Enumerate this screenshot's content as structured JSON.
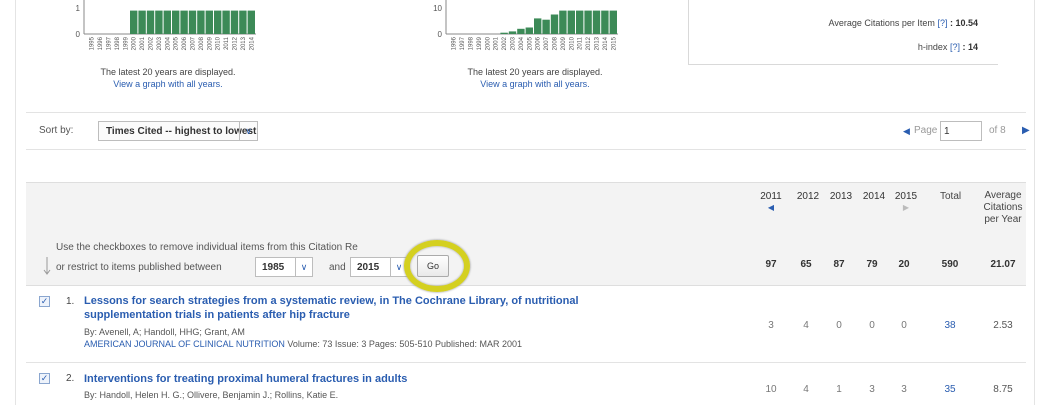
{
  "top_charts": [
    {
      "y_ticks": [
        "1",
        "0"
      ],
      "years": [
        "1995",
        "1996",
        "1997",
        "1998",
        "1999",
        "2000",
        "2001",
        "2002",
        "2003",
        "2004",
        "2005",
        "2006",
        "2007",
        "2008",
        "2009",
        "2010",
        "2011",
        "2012",
        "2013",
        "2014"
      ],
      "bar_levels": [
        0,
        0,
        0,
        0,
        0,
        0.9,
        0.9,
        0.9,
        0.9,
        0.9,
        0.9,
        0.9,
        0.9,
        0.9,
        0.9,
        0.9,
        0.9,
        0.9,
        0.9,
        0.9
      ],
      "caption": "The latest 20 years are displayed.",
      "link": "View a graph with all years."
    },
    {
      "y_ticks": [
        "10",
        "0"
      ],
      "years": [
        "1996",
        "1997",
        "1998",
        "1999",
        "2000",
        "2001",
        "2002",
        "2003",
        "2004",
        "2005",
        "2006",
        "2007",
        "2008",
        "2009",
        "2010",
        "2011",
        "2012",
        "2013",
        "2014",
        "2015"
      ],
      "bar_levels": [
        0,
        0,
        0,
        0,
        0,
        0,
        0.05,
        0.1,
        0.2,
        0.25,
        0.6,
        0.55,
        0.75,
        0.9,
        0.9,
        0.9,
        0.9,
        0.9,
        0.9,
        0.9
      ],
      "caption": "The latest 20 years are displayed.",
      "link": "View a graph with all years."
    }
  ],
  "bar_color": "#3c8a57",
  "accent_color": "#2a5db0",
  "metrics": {
    "avg_label": "Average Citations per Item",
    "avg_help": "[?]",
    "avg_value": ": 10.54",
    "h_label": "h-index",
    "h_help": "[?]",
    "h_value": ": 14"
  },
  "sort": {
    "label": "Sort by:",
    "value": "Times Cited -- highest to lowest",
    "chevron": "∨"
  },
  "pager": {
    "prev": "◀",
    "label": "Page",
    "current": "1",
    "of": "of 8",
    "next": "▶"
  },
  "table": {
    "years": [
      "2011",
      "2012",
      "2013",
      "2014",
      "2015"
    ],
    "year_left_arrow": "◀",
    "year_right_arrow": "▶",
    "total_label": "Total",
    "avg_label_1": "Average",
    "avg_label_2": "Citations",
    "avg_label_3": "per Year",
    "help_text": "Use the checkboxes to remove individual items from this Citation Re",
    "restrict_text": "or restrict to items published between",
    "from_year": "1985",
    "and_label": "and",
    "to_year": "2015",
    "go": "Go",
    "summary": [
      "97",
      "65",
      "87",
      "79",
      "20",
      "590",
      "21.07"
    ]
  },
  "rows": [
    {
      "checked": "✓",
      "num": "1.",
      "title_line1": "Lessons for search strategies from a systematic review, in The Cochrane Library, of nutritional",
      "title_line2": "supplementation trials in patients after hip fracture",
      "authors": "By: Avenell, A; Handoll, HHG; Grant, AM",
      "journal": "AMERICAN JOURNAL OF CLINICAL NUTRITION",
      "details": "  Volume: 73   Issue: 3   Pages: 505-510   Published: MAR 2001",
      "cells": [
        "3",
        "4",
        "0",
        "0",
        "0",
        "38",
        "2.53"
      ]
    },
    {
      "checked": "✓",
      "num": "2.",
      "title_line1": "Interventions for treating proximal humeral fractures in adults",
      "authors": "By: Handoll, Helen H. G.; Ollivere, Benjamin J.; Rollins, Katie E.",
      "cells": [
        "10",
        "4",
        "1",
        "3",
        "3",
        "35",
        "8.75"
      ]
    }
  ]
}
